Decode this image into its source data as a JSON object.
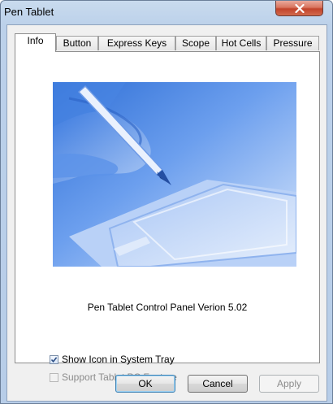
{
  "window": {
    "title": "Pen Tablet"
  },
  "tabs": [
    {
      "label": "Info",
      "active": true
    },
    {
      "label": "Button",
      "active": false
    },
    {
      "label": "Express Keys",
      "active": false
    },
    {
      "label": "Scope",
      "active": false
    },
    {
      "label": "Hot Cells",
      "active": false
    },
    {
      "label": "Pressure",
      "active": false
    }
  ],
  "info": {
    "version_text": "Pen Tablet Control Panel Verion 5.02",
    "options": [
      {
        "label": "Show Icon in System Tray",
        "checked": true,
        "enabled": true
      },
      {
        "label": "Support Tablet PC Feature",
        "checked": false,
        "enabled": false
      }
    ]
  },
  "buttons": {
    "ok": "OK",
    "cancel": "Cancel",
    "apply": "Apply"
  },
  "colors": {
    "accent": "#3c7fb1",
    "hero_blue": "#5b92e8",
    "close_red": "#c2432a"
  }
}
